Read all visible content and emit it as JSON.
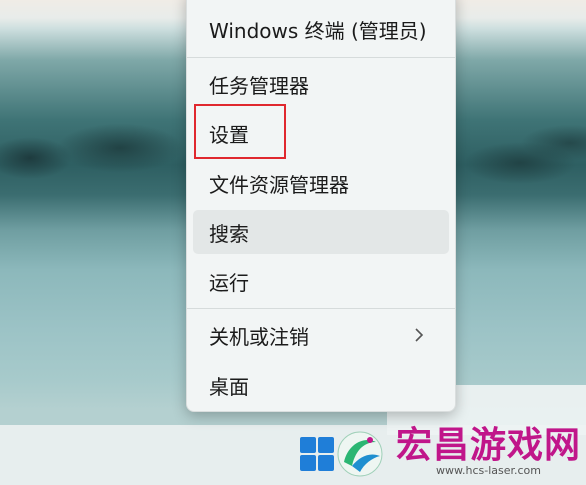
{
  "menu": {
    "items": [
      {
        "id": "terminal-admin",
        "label": "Windows 终端 (管理员)"
      },
      {
        "id": "task-manager",
        "label": "任务管理器"
      },
      {
        "id": "settings",
        "label": "设置"
      },
      {
        "id": "file-explorer",
        "label": "文件资源管理器"
      },
      {
        "id": "search",
        "label": "搜索"
      },
      {
        "id": "run",
        "label": "运行"
      },
      {
        "id": "shutdown",
        "label": "关机或注销"
      },
      {
        "id": "desktop",
        "label": "桌面"
      }
    ],
    "highlighted_item": "设置",
    "hovered_item": "搜索"
  },
  "taskbar": {
    "start_icon": "windows-logo-icon"
  },
  "watermark": {
    "title": "宏昌游戏网",
    "url": "www.hcs-laser.com"
  },
  "colors": {
    "highlight_box": "#e0282e",
    "start_icon": "#1f7ed8",
    "watermark_title": "#c0168a"
  }
}
